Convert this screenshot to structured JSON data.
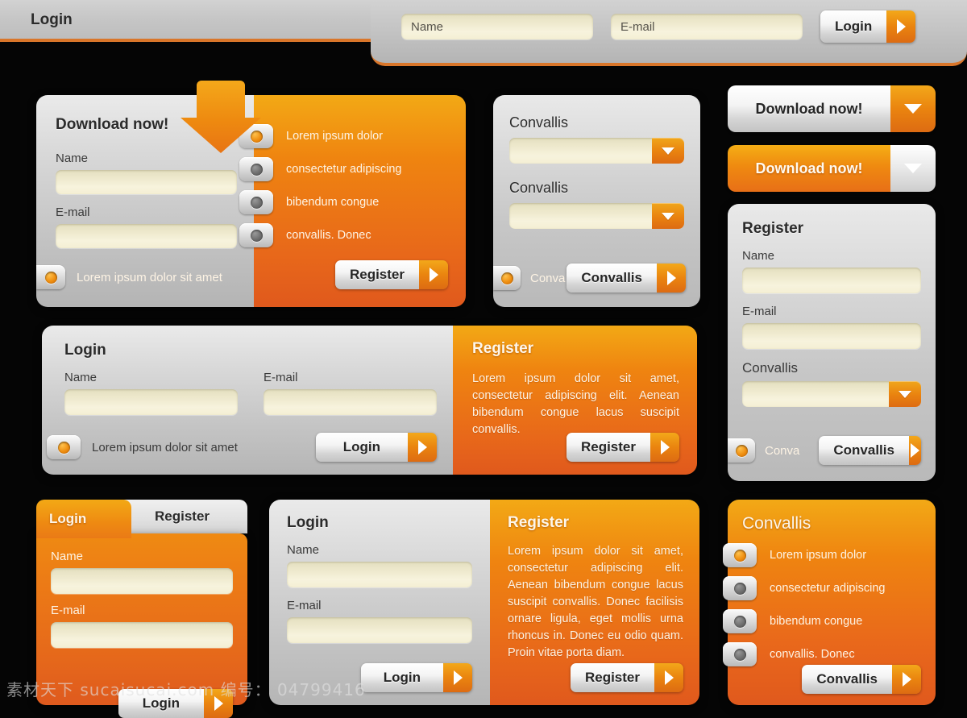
{
  "topbar": {
    "tab_label": "Login",
    "name_placeholder": "Name",
    "email_placeholder": "E-mail",
    "login_label": "Login",
    "accent": "#d9762a"
  },
  "download_card": {
    "title": "Download now!",
    "name_label": "Name",
    "email_label": "E-mail",
    "consent_text": "Lorem ipsum dolor sit amet",
    "features": [
      "Lorem  ipsum  dolor",
      "consectetur adipiscing",
      "bibendum  congue",
      "convallis.  Donec"
    ],
    "register_label": "Register"
  },
  "select_card": {
    "label_one": "Convallis",
    "label_two": "Convallis",
    "consent_text": "Conva",
    "button_label": "Convallis"
  },
  "download_buttons": [
    {
      "label": "Download now!",
      "style": "light"
    },
    {
      "label": "Download now!",
      "style": "orange"
    }
  ],
  "register_card": {
    "title": "Register",
    "name_label": "Name",
    "email_label": "E-mail",
    "select_label": "Convallis",
    "consent_text": "Conva",
    "button_label": "Convallis"
  },
  "wide_card": {
    "login_title": "Login",
    "name_label": "Name",
    "email_label": "E-mail",
    "consent_text": "Lorem ipsum dolor sit amet",
    "login_button": "Login",
    "register_title": "Register",
    "register_body": "Lorem  ipsum  dolor  sit  amet, consectetur adipiscing elit. Aenean bibendum  congue  lacus  suscipit convallis.",
    "register_button": "Register"
  },
  "tabs_card": {
    "tab_active": "Login",
    "tab_inactive": "Register",
    "name_label": "Name",
    "email_label": "E-mail",
    "button_label": "Login"
  },
  "bottom_split": {
    "login_title": "Login",
    "name_label": "Name",
    "email_label": "E-mail",
    "login_button": "Login",
    "register_title": "Register",
    "register_body": "Lorem  ipsum  dolor  sit  amet, consectetur adipiscing elit. Aenean bibendum  congue  lacus  suscipit convallis.  Donec  facilisis  ornare ligula, eget mollis urna rhoncus in. Donec  eu  odio  quam.  Proin  vitae porta diam.",
    "register_button": "Register"
  },
  "list_card": {
    "title": "Convallis",
    "items": [
      "Lorem   ipsum   dolor",
      "consectetur adipiscing",
      "bibendum  congue",
      "convallis.  Donec"
    ],
    "button_label": "Convallis"
  },
  "watermark": "素材天下 sucaisucai.com  编号： 04799416"
}
